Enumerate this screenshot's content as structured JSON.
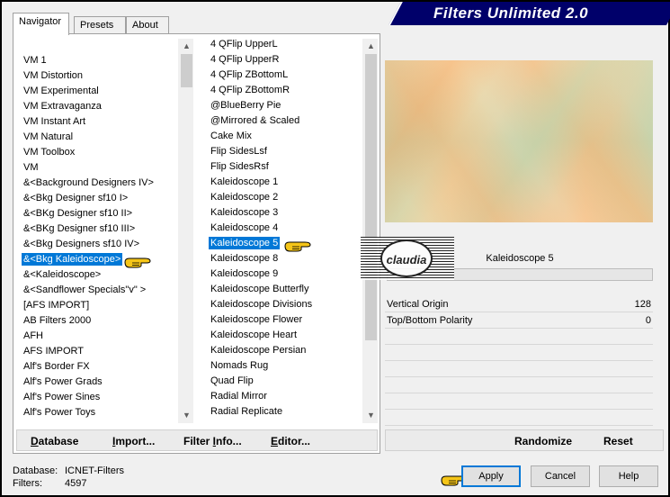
{
  "window": {
    "title": "Filters Unlimited 2.0"
  },
  "tabs": [
    {
      "label": "Navigator",
      "active": true
    },
    {
      "label": "Presets",
      "active": false
    },
    {
      "label": "About",
      "active": false
    }
  ],
  "categories": {
    "items": [
      "VM 1",
      "VM Distortion",
      "VM Experimental",
      "VM Extravaganza",
      "VM Instant Art",
      "VM Natural",
      "VM Toolbox",
      "VM",
      "&<Background Designers IV>",
      "&<Bkg Designer sf10 I>",
      "&<BKg Designer sf10 II>",
      "&<BKg Designer sf10 III>",
      "&<Bkg Designers sf10 IV>",
      "&<Bkg Kaleidoscope>",
      "&<Kaleidoscope>",
      "&<Sandflower Specials\"v\" >",
      "[AFS IMPORT]",
      "AB Filters 2000",
      "AFH",
      "AFS IMPORT",
      "Alf's Border FX",
      "Alf's Power Grads",
      "Alf's Power Sines",
      "Alf's Power Toys"
    ],
    "selected_index": 13
  },
  "filters": {
    "items": [
      "4 QFlip UpperL",
      "4 QFlip UpperR",
      "4 QFlip ZBottomL",
      "4 QFlip ZBottomR",
      "@BlueBerry Pie",
      "@Mirrored & Scaled",
      "Cake Mix",
      "Flip SidesLsf",
      "Flip SidesRsf",
      "Kaleidoscope 1",
      "Kaleidoscope 2",
      "Kaleidoscope 3",
      "Kaleidoscope 4",
      "Kaleidoscope 5",
      "Kaleidoscope 8",
      "Kaleidoscope 9",
      "Kaleidoscope Butterfly",
      "Kaleidoscope Divisions",
      "Kaleidoscope Flower",
      "Kaleidoscope Heart",
      "Kaleidoscope Persian",
      "Nomads Rug",
      "Quad Flip",
      "Radial Mirror",
      "Radial Replicate"
    ],
    "selected_index": 13
  },
  "left_buttons": {
    "database": {
      "u": "D",
      "rest": "atabase"
    },
    "import": {
      "u": "I",
      "rest": "mport..."
    },
    "filter_info": {
      "pre": "Filter ",
      "u": "I",
      "rest": "nfo..."
    },
    "editor": {
      "u": "E",
      "rest": "ditor..."
    }
  },
  "preview": {
    "filter_name": "Kaleidoscope 5"
  },
  "params": [
    {
      "label": "Vertical Origin",
      "value": "128"
    },
    {
      "label": "Top/Bottom Polarity",
      "value": "0"
    }
  ],
  "right_buttons": {
    "randomize": "Randomize",
    "reset": "Reset"
  },
  "status": {
    "database_label": "Database:",
    "database_value": "ICNET-Filters",
    "filters_label": "Filters:",
    "filters_value": "4597"
  },
  "dialog_buttons": {
    "apply": "Apply",
    "cancel": "Cancel",
    "help": "Help"
  },
  "watermark": {
    "text": "claudia"
  },
  "colors": {
    "title_bar": "#00006a",
    "selection": "#0078d7",
    "pointer": "#f5c518"
  },
  "icons": {
    "hand_pointer": "pointing-hand-icon"
  }
}
